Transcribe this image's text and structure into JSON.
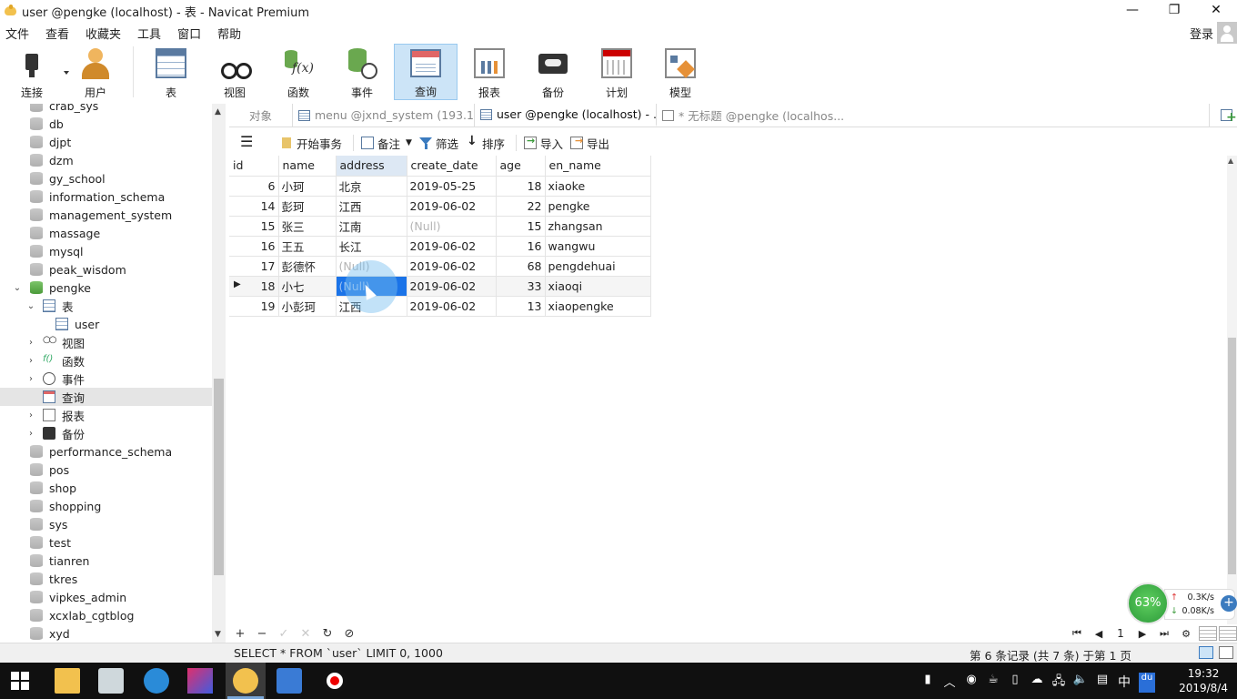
{
  "window": {
    "title": "user @pengke (localhost) - 表 - Navicat Premium",
    "controls": [
      "—",
      "❐",
      "✕"
    ]
  },
  "menu": {
    "items": [
      "文件",
      "查看",
      "收藏夹",
      "工具",
      "窗口",
      "帮助"
    ],
    "login": "登录"
  },
  "toolbar": {
    "buttons": [
      {
        "label": "连接",
        "icon": "plug-icon"
      },
      {
        "label": "用户",
        "icon": "user-icon"
      },
      {
        "label": "表",
        "icon": "table-icon"
      },
      {
        "label": "视图",
        "icon": "view-icon"
      },
      {
        "label": "函数",
        "icon": "function-icon"
      },
      {
        "label": "事件",
        "icon": "event-icon"
      },
      {
        "label": "查询",
        "icon": "query-icon",
        "active": true
      },
      {
        "label": "报表",
        "icon": "report-icon"
      },
      {
        "label": "备份",
        "icon": "backup-icon"
      },
      {
        "label": "计划",
        "icon": "schedule-icon"
      },
      {
        "label": "模型",
        "icon": "model-icon"
      }
    ]
  },
  "sidebar": {
    "databases_top": [
      "crab_sys",
      "db",
      "djpt",
      "dzm",
      "gy_school",
      "information_schema",
      "management_system",
      "massage",
      "mysql",
      "peak_wisdom"
    ],
    "open_db": "pengke",
    "tables_node": "表",
    "table_user": "user",
    "view_node": "视图",
    "func_node": "函数",
    "event_node": "事件",
    "query_node": "查询",
    "report_node": "报表",
    "backup_node": "备份",
    "databases_bottom": [
      "performance_schema",
      "pos",
      "shop",
      "shopping",
      "sys",
      "test",
      "tianren",
      "tkres",
      "vipkes_admin",
      "xcxlab_cgtblog",
      "xyd"
    ]
  },
  "tabs": [
    {
      "label": "对象"
    },
    {
      "label": "menu @jxnd_system (193.11..."
    },
    {
      "label": "user @pengke (localhost) - ..."
    },
    {
      "label": "* 无标题 @pengke (localhos..."
    }
  ],
  "editor_toolbar": {
    "begin_tx": "开始事务",
    "note": "备注",
    "filter": "筛选",
    "sort": "排序",
    "import": "导入",
    "export": "导出"
  },
  "grid": {
    "columns": [
      "id",
      "name",
      "address",
      "create_date",
      "age",
      "en_name"
    ],
    "rows": [
      [
        "6",
        "小珂",
        "北京",
        "2019-05-25",
        "18",
        "xiaoke"
      ],
      [
        "14",
        "彭珂",
        "江西",
        "2019-06-02",
        "22",
        "pengke"
      ],
      [
        "15",
        "张三",
        "江南",
        "(Null)",
        "15",
        "zhangsan"
      ],
      [
        "16",
        "王五",
        "长江",
        "2019-06-02",
        "16",
        "wangwu"
      ],
      [
        "17",
        "彭德怀",
        "(Null)",
        "2019-06-02",
        "68",
        "pengdehuai"
      ],
      [
        "18",
        "小七",
        "(Null)",
        "2019-06-02",
        "33",
        "xiaoqi"
      ],
      [
        "19",
        "小彭珂",
        "江西",
        "2019-06-02",
        "13",
        "xiaopengke"
      ]
    ],
    "current_row_marker": "▶"
  },
  "widget": {
    "percent": "63%",
    "up": "0.3K/s",
    "down": "0.08K/s"
  },
  "grid_nav": {
    "page": "1"
  },
  "status": {
    "sql": "SELECT * FROM `user` LIMIT 0, 1000",
    "record": "第 6 条记录 (共 7 条) 于第 1 页"
  },
  "taskbar": {
    "time": "19:32",
    "date": "2019/8/4",
    "ime": "中",
    "du": "du"
  }
}
